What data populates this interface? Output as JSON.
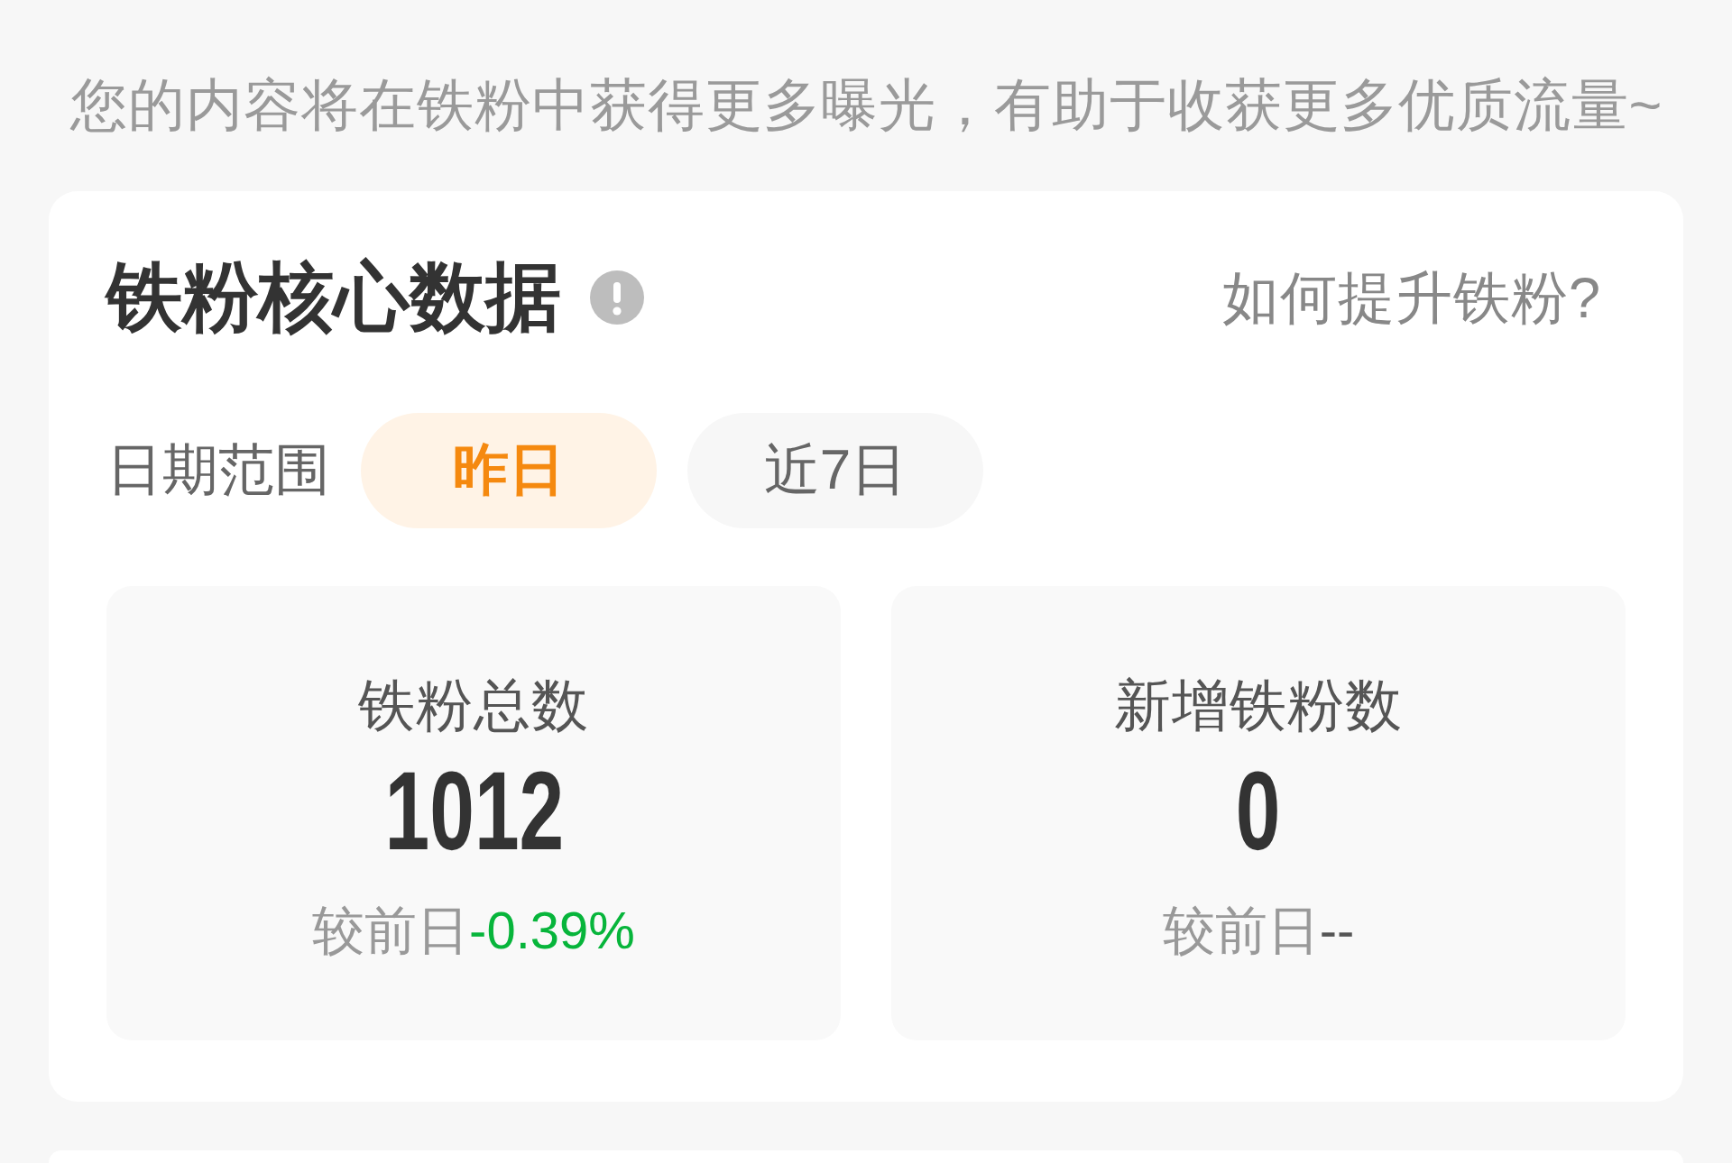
{
  "banner": {
    "text": "您的内容将在铁粉中获得更多曝光，有助于收获更多优质流量~"
  },
  "card": {
    "title": "铁粉核心数据",
    "help_link": "如何提升铁粉?",
    "date_range": {
      "label": "日期范围",
      "options": [
        {
          "label": "昨日",
          "selected": true
        },
        {
          "label": "近7日",
          "selected": false
        }
      ]
    },
    "stats": [
      {
        "label": "铁粉总数",
        "value": "1012",
        "compare_label": "较前日",
        "change": "-0.39%",
        "color": "#07b53b"
      },
      {
        "label": "新增铁粉数",
        "value": "0",
        "compare_label": "较前日",
        "change": "--",
        "color": "#555555"
      }
    ]
  }
}
